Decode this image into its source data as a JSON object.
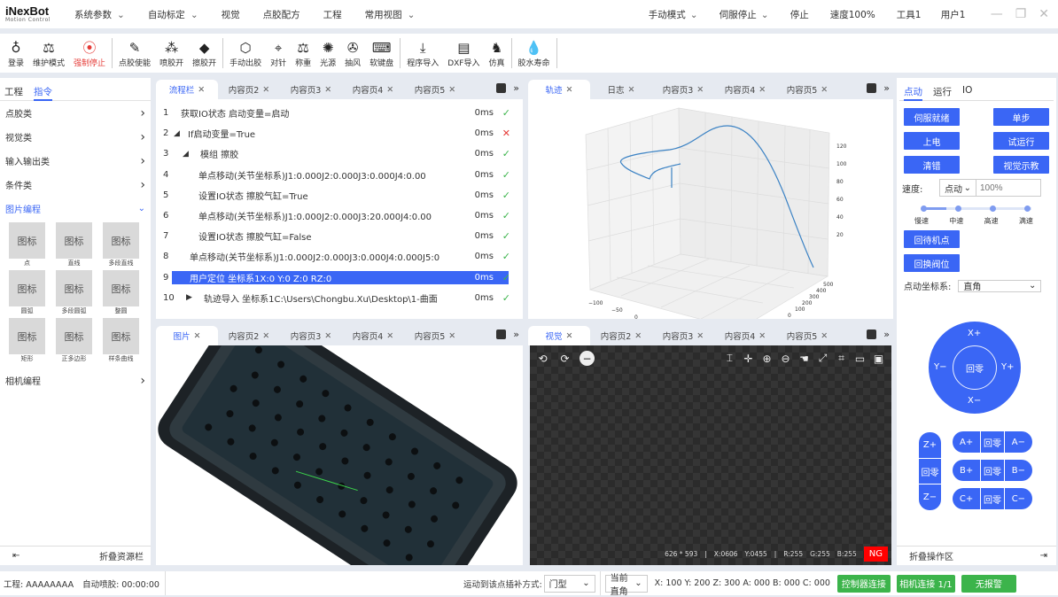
{
  "brand": {
    "name": "iNexBot",
    "sub": "Motion Control"
  },
  "menu": [
    {
      "label": "系统参数",
      "dd": true
    },
    {
      "label": "自动标定",
      "dd": true
    },
    {
      "label": "视觉",
      "dd": false
    },
    {
      "label": "点胶配方",
      "dd": false
    },
    {
      "label": "工程",
      "dd": false
    },
    {
      "label": "常用视图",
      "dd": true
    }
  ],
  "status_menu": [
    {
      "label": "手动模式",
      "dd": true
    },
    {
      "label": "伺服停止",
      "dd": true
    },
    {
      "label": "停止",
      "dd": false
    },
    {
      "label": "速度100%",
      "dd": false
    },
    {
      "label": "工具1",
      "dd": false
    },
    {
      "label": "用户1",
      "dd": false
    }
  ],
  "toolbar": [
    {
      "label": "登录",
      "icon": "user-icon",
      "glyph": "♁"
    },
    {
      "label": "维护模式",
      "icon": "scale-icon",
      "glyph": "⚖"
    },
    {
      "label": "强制停止",
      "icon": "stop-icon",
      "glyph": "⦿",
      "red": true
    },
    {
      "sep": true
    },
    {
      "label": "点胶使能",
      "icon": "dispenser-icon",
      "glyph": "✎"
    },
    {
      "label": "喷胶开",
      "icon": "spray-icon",
      "glyph": "⁂"
    },
    {
      "label": "擦胶开",
      "icon": "eraser-icon",
      "glyph": "◆"
    },
    {
      "sep": true
    },
    {
      "label": "手动出胶",
      "icon": "nut-icon",
      "glyph": "⬡"
    },
    {
      "label": "对针",
      "icon": "crosshair-icon",
      "glyph": "⌖"
    },
    {
      "label": "称重",
      "icon": "weigh-icon",
      "glyph": "⚖"
    },
    {
      "label": "光源",
      "icon": "light-icon",
      "glyph": "✺"
    },
    {
      "label": "抽风",
      "icon": "fan-icon",
      "glyph": "✇"
    },
    {
      "label": "软键盘",
      "icon": "keyboard-icon",
      "glyph": "⌨"
    },
    {
      "sep": true
    },
    {
      "label": "程序导入",
      "icon": "import-icon",
      "glyph": "⤓"
    },
    {
      "label": "DXF导入",
      "icon": "dxf-icon",
      "glyph": "▤"
    },
    {
      "label": "仿真",
      "icon": "horse-icon",
      "glyph": "♞"
    },
    {
      "sep": true
    },
    {
      "label": "胶水寿命",
      "icon": "drop-icon",
      "glyph": "💧"
    },
    {
      "sep": true
    }
  ],
  "left": {
    "tabs": [
      "工程",
      "指令"
    ],
    "active_tab": 1,
    "categories": [
      "点胶类",
      "视觉类",
      "输入输出类",
      "条件类"
    ],
    "image_cat": "图片编程",
    "icon_placeholder": "图标",
    "image_items": [
      "点",
      "直线",
      "多段直线",
      "圆弧",
      "多段圆弧",
      "整圆",
      "矩形",
      "正多边形",
      "样条曲线"
    ],
    "camera_cat": "相机编程",
    "footer": "折叠资源栏"
  },
  "flow": {
    "tabs": [
      "流程栏",
      "内容页2",
      "内容页3",
      "内容页4",
      "内容页5"
    ],
    "rows": [
      {
        "n": "1",
        "indent": 0,
        "arrow": "",
        "text": "获取IO状态 启动变量=启动",
        "ms": "0ms",
        "ok": true
      },
      {
        "n": "2",
        "indent": 0,
        "arrow": "◢",
        "text": "If启动变量=True",
        "ms": "0ms",
        "ok": false
      },
      {
        "n": "3",
        "indent": 1,
        "arrow": "◢",
        "text": "模组 擦胶",
        "ms": "0ms",
        "ok": true
      },
      {
        "n": "4",
        "indent": 3,
        "arrow": "",
        "text": "单点移动(关节坐标系)J1:0.000J2:0.000J3:0.000J4:0.00",
        "ms": "0ms",
        "ok": true
      },
      {
        "n": "5",
        "indent": 3,
        "arrow": "",
        "text": "设置IO状态 擦胶气缸=True",
        "ms": "0ms",
        "ok": true
      },
      {
        "n": "6",
        "indent": 3,
        "arrow": "",
        "text": "单点移动(关节坐标系)J1:0.000J2:0.000J3:20.000J4:0.00",
        "ms": "0ms",
        "ok": true
      },
      {
        "n": "7",
        "indent": 3,
        "arrow": "",
        "text": "设置IO状态 擦胶气缸=False",
        "ms": "0ms",
        "ok": true
      },
      {
        "n": "8",
        "indent": 2,
        "arrow": "",
        "text": "单点移动(关节坐标系)J1:0.000J2:0.000J3:0.000J4:0.000J5:0",
        "ms": "0ms",
        "ok": true
      },
      {
        "n": "9",
        "indent": 2,
        "arrow": "",
        "text": "用户定位 坐标系1X:0 Y:0 Z:0 RZ:0",
        "ms": "0ms",
        "ok": true,
        "selected": true
      },
      {
        "n": "10",
        "indent": 1,
        "arrow": "▶",
        "text": "轨迹导入 坐标系1C:\\Users\\Chongbu.Xu\\Desktop\\1-曲面",
        "ms": "0ms",
        "ok": true
      }
    ]
  },
  "track": {
    "tabs": [
      "轨迹",
      "日志",
      "内容页3",
      "内容页4",
      "内容页5"
    ],
    "z_ticks": [
      "120",
      "100",
      "80",
      "60",
      "40",
      "20"
    ],
    "x_ticks": [
      "−100",
      "−50",
      "0",
      "50",
      "100",
      "150",
      "200"
    ],
    "y_ticks": [
      "500",
      "400",
      "300",
      "200",
      "100",
      "0",
      "−100",
      "−200"
    ],
    "line_color": "#3b82c4"
  },
  "image_panel": {
    "tabs": [
      "图片",
      "内容页2",
      "内容页3",
      "内容页4",
      "内容页5"
    ]
  },
  "vision": {
    "tabs": [
      "视觉",
      "内容页2",
      "内容页3",
      "内容页4",
      "内容页5"
    ],
    "size": "626 * 593",
    "x": "X:0606",
    "y": "Y:0455",
    "r": "R:255",
    "g": "G:255",
    "b": "B:255",
    "result": "NG"
  },
  "right": {
    "tabs": [
      "点动",
      "运行",
      "IO"
    ],
    "active_tab": 0,
    "buttons": [
      [
        "伺服就绪",
        "单步"
      ],
      [
        "上电",
        "试运行"
      ],
      [
        "清错",
        "视觉示教"
      ]
    ],
    "speed_label": "速度:",
    "speed_mode": "点动",
    "speed_placeholder": "100%",
    "speed_levels": [
      "慢速",
      "中速",
      "高速",
      "满速"
    ],
    "speed_level": 0,
    "home_wait": "回待机点",
    "home_valve": "回换阀位",
    "coord_label": "点动坐标系:",
    "coord_value": "直角",
    "jog": {
      "xp": "X+",
      "xm": "X−",
      "yp": "Y+",
      "ym": "Y−",
      "home": "回零"
    },
    "axes": [
      {
        "p": "A+",
        "m": "A−"
      },
      {
        "p": "B+",
        "m": "B−"
      },
      {
        "p": "C+",
        "m": "C−"
      }
    ],
    "z": {
      "p": "Z+",
      "m": "Z−"
    },
    "footer": "折叠操作区"
  },
  "statusbar": {
    "project": "工程: AAAAAAAA",
    "auto": "自动喷胶: 00:00:00",
    "interp_label": "运动到该点插补方式:",
    "interp_value": "门型",
    "frame_value": "当前直角",
    "coords": "X: 100 Y: 200 Z: 300 A: 000 B: 000 C: 000",
    "controller": "控制器连接",
    "camera": "相机连接 1/1",
    "alarm": "无报警"
  },
  "colors": {
    "accent": "#3a66f5",
    "ok": "#3cb44b",
    "error": "#e53935",
    "ng": "#ff0000"
  }
}
